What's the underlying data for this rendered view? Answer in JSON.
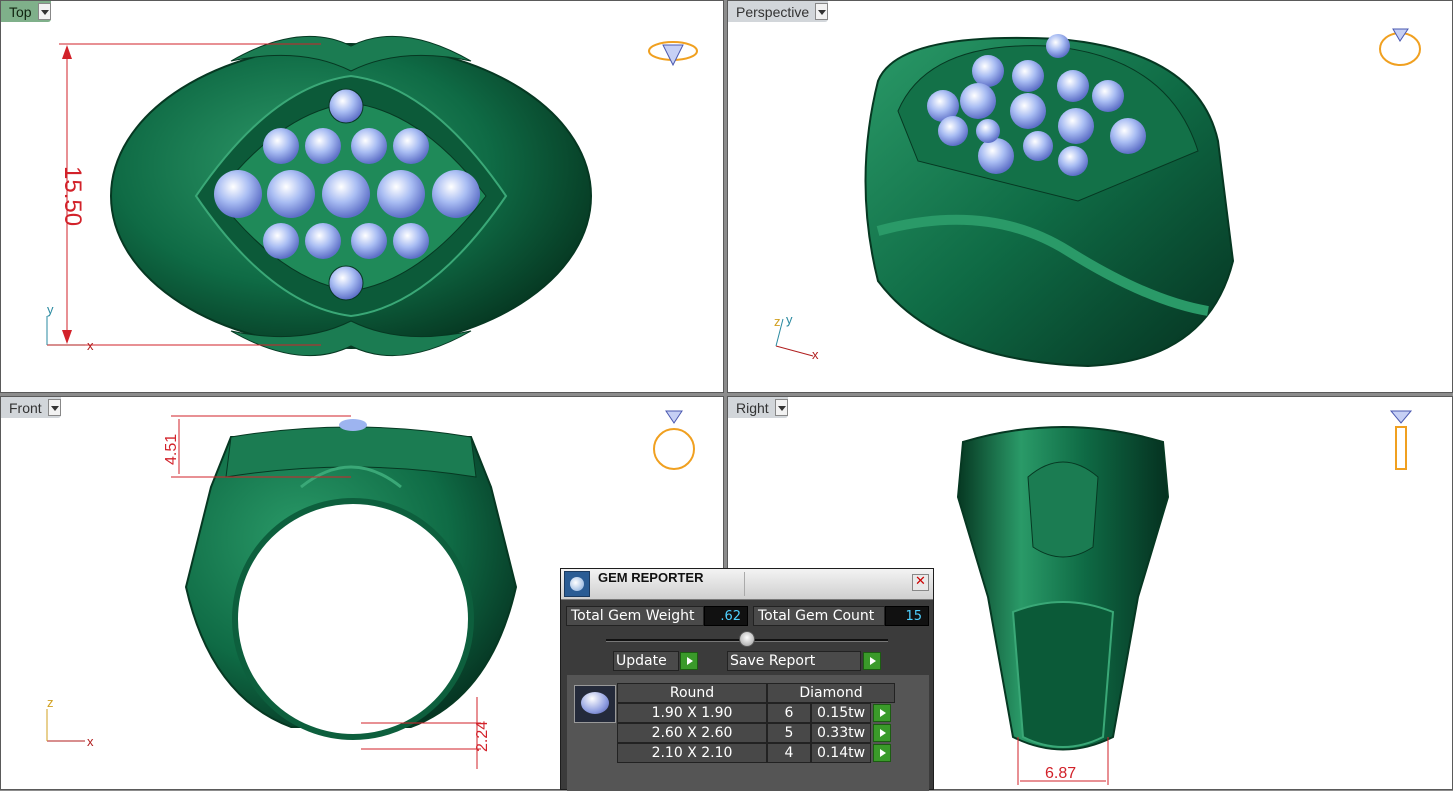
{
  "viewports": {
    "top": {
      "label": "Top"
    },
    "perspective": {
      "label": "Perspective"
    },
    "front": {
      "label": "Front"
    },
    "right": {
      "label": "Right"
    }
  },
  "dimensions": {
    "top_height": "15.50",
    "front_top": "4.51",
    "front_bottom": "2.24",
    "right_width": "6.87"
  },
  "axes": {
    "x": "x",
    "y": "y",
    "z": "z"
  },
  "colors": {
    "ring_green": "#0f6b45",
    "gem_blue": "#9db4f0",
    "dimension_red": "#d2222a",
    "active_tab": "#7fb08a"
  },
  "gem_reporter": {
    "title": "GEM REPORTER",
    "total_weight_label": "Total Gem Weight",
    "total_weight_value": ".62",
    "total_count_label": "Total Gem Count",
    "total_count_value": "15",
    "update_label": "Update",
    "save_label": "Save Report",
    "header_shape": "Round",
    "header_material": "Diamond",
    "rows": [
      {
        "size": "1.90 X 1.90",
        "count": "6",
        "weight": "0.15tw"
      },
      {
        "size": "2.60 X 2.60",
        "count": "5",
        "weight": "0.33tw"
      },
      {
        "size": "2.10 X 2.10",
        "count": "4",
        "weight": "0.14tw"
      }
    ]
  }
}
